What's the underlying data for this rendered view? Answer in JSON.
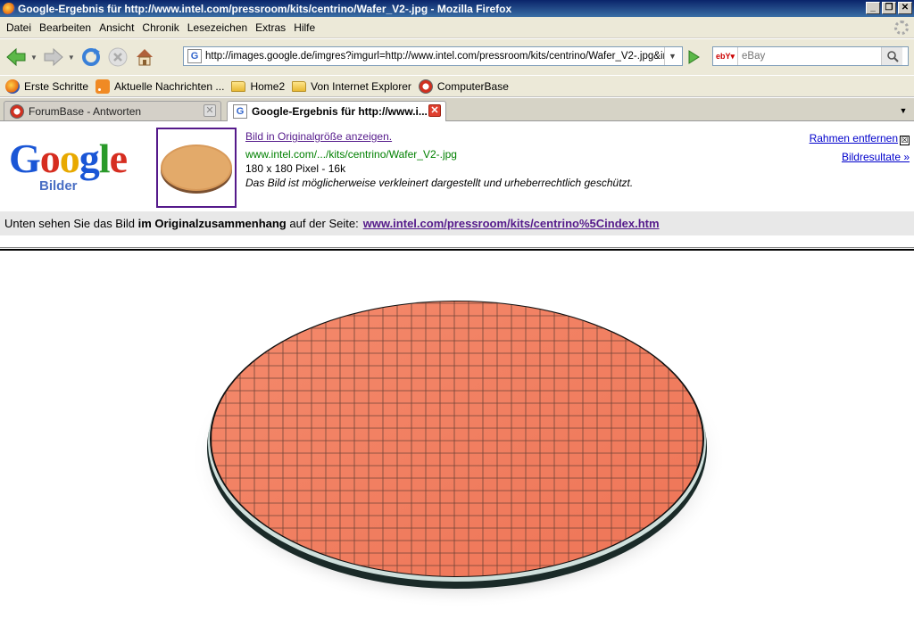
{
  "window": {
    "title": "Google-Ergebnis für http://www.intel.com/pressroom/kits/centrino/Wafer_V2-.jpg - Mozilla Firefox"
  },
  "menu": [
    "Datei",
    "Bearbeiten",
    "Ansicht",
    "Chronik",
    "Lesezeichen",
    "Extras",
    "Hilfe"
  ],
  "nav": {
    "url": "http://images.google.de/imgres?imgurl=http://www.intel.com/pressroom/kits/centrino/Wafer_V2-.jpg&imgr",
    "search_placeholder": "eBay",
    "search_engine_icon": "ebay-icon"
  },
  "bookmarks": [
    {
      "label": "Erste Schritte",
      "icon": "firefox-icon"
    },
    {
      "label": "Aktuelle Nachrichten ...",
      "icon": "rss-icon"
    },
    {
      "label": "Home2",
      "icon": "folder-icon"
    },
    {
      "label": "Von Internet Explorer",
      "icon": "folder-icon"
    },
    {
      "label": "ComputerBase",
      "icon": "computerbase-icon"
    }
  ],
  "tabs": [
    {
      "label": "ForumBase - Antworten",
      "active": false
    },
    {
      "label": "Google-Ergebnis für http://www.i...",
      "active": true
    }
  ],
  "google": {
    "logo_word": "Google",
    "logo_sub": "Bilder",
    "full_size_link": "Bild in Originalgröße anzeigen.",
    "source_url": "www.intel.com/.../kits/centrino/Wafer_V2-.jpg",
    "size_info": "180 x 180 Pixel - 16k",
    "notice": "Das Bild ist möglicherweise verkleinert dargestellt und urheberrechtlich geschützt.",
    "remove_frame": "Rahmen entfernen",
    "remove_frame_x": "☒",
    "image_results": "Bildresultate »",
    "context_prefix": "Unten sehen Sie das Bild",
    "context_bold": "im Originalzusammenhang",
    "context_suffix": "auf der Seite:",
    "context_link": "www.intel.com/pressroom/kits/centrino%5Cindex.htm"
  },
  "colors": {
    "wafer": "#f08060",
    "link": "#551a8b",
    "green": "#008000"
  }
}
